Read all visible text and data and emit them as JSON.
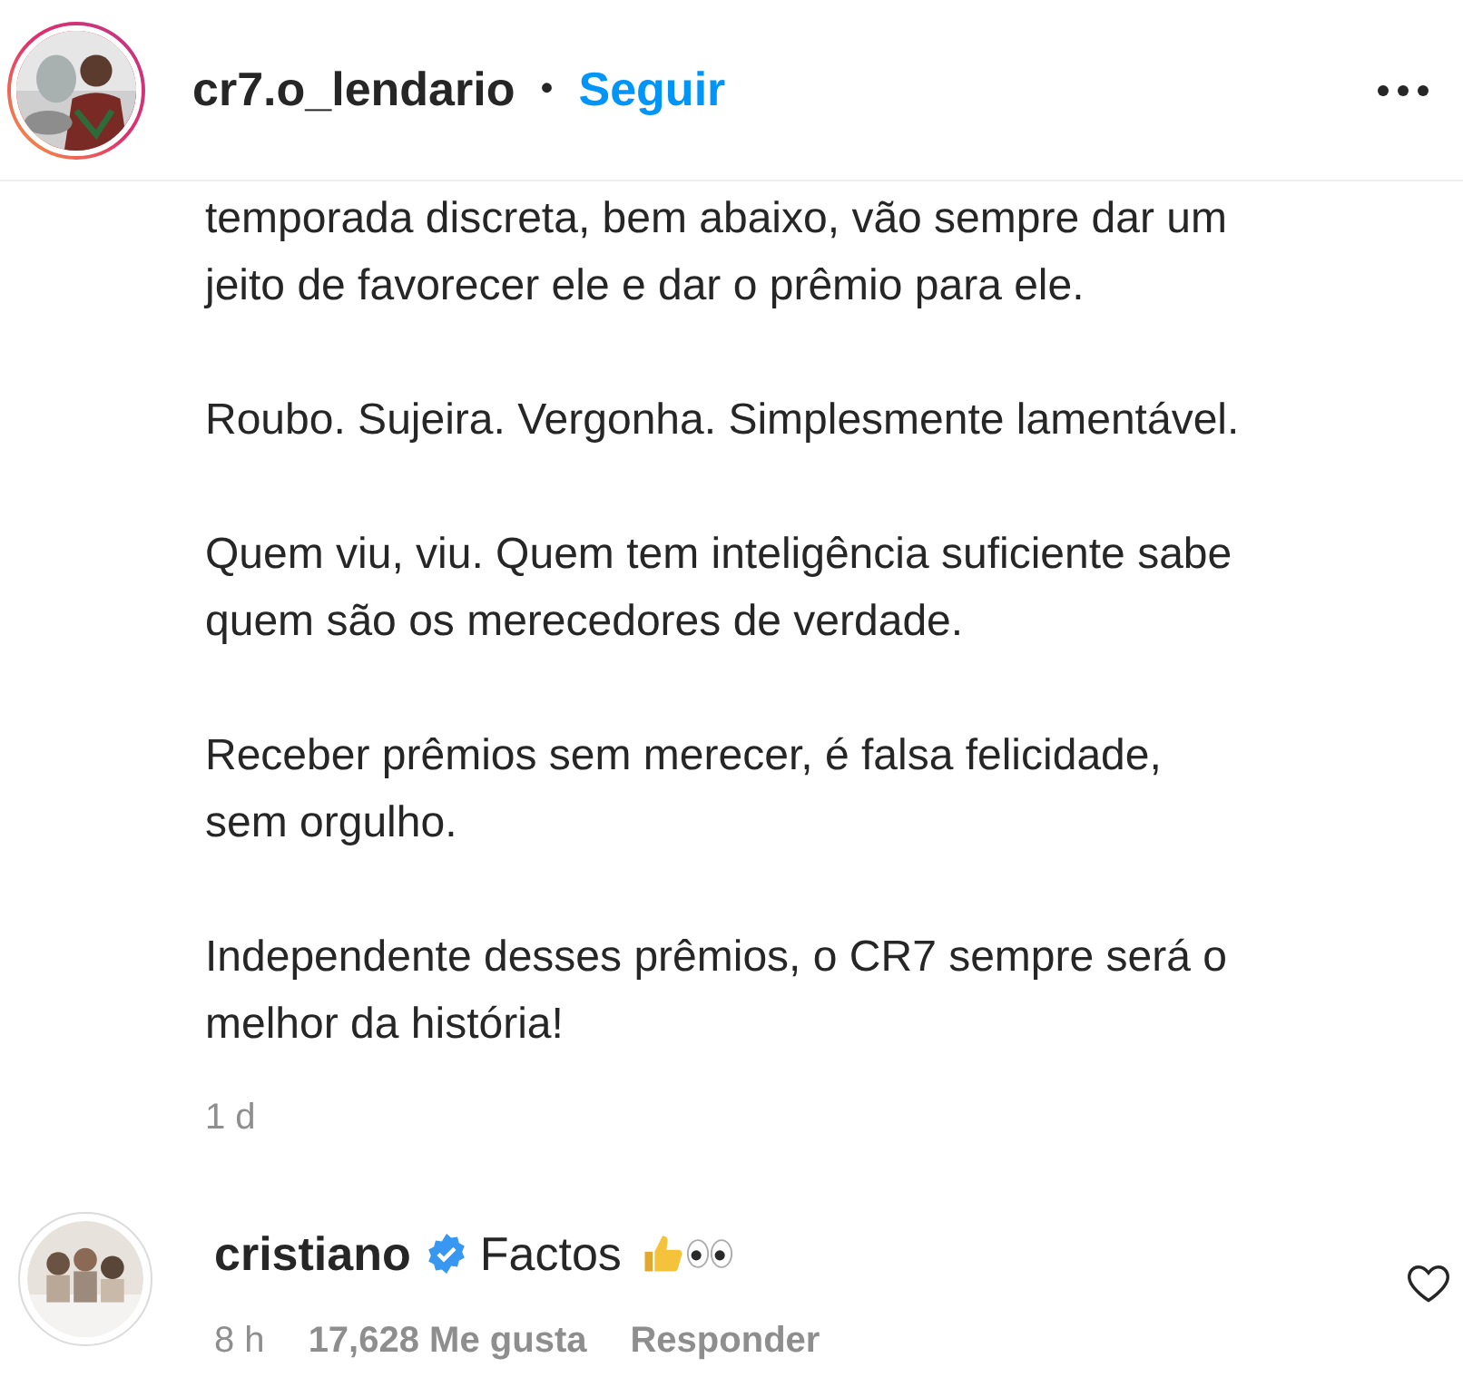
{
  "header": {
    "avatar": {
      "story_ring": true
    },
    "username": "cr7.o_lendario",
    "separator": "•",
    "follow_button": "Seguir"
  },
  "caption": {
    "paragraphs": [
      {
        "lines": [
          "temporada discreta, bem abaixo, vão sempre dar um",
          "jeito de favorecer ele e dar o prêmio para ele."
        ]
      },
      {
        "lines": [
          "Roubo. Sujeira. Vergonha. Simplesmente lamentável."
        ]
      },
      {
        "lines": [
          "Quem viu, viu. Quem tem inteligência suficiente sabe",
          "quem são os merecedores de verdade."
        ]
      },
      {
        "lines": [
          "Receber prêmios sem merecer, é falsa felicidade,",
          "sem orgulho."
        ]
      },
      {
        "lines": [
          "Independente desses prêmios, o CR7 sempre será o",
          "melhor da história!"
        ]
      }
    ],
    "time": "1 d"
  },
  "comment": {
    "username": "cristiano",
    "verified": true,
    "text": "Factos",
    "liked": false,
    "time": "8 h",
    "likes": "17,628 Me gusta",
    "reply": "Responder"
  }
}
